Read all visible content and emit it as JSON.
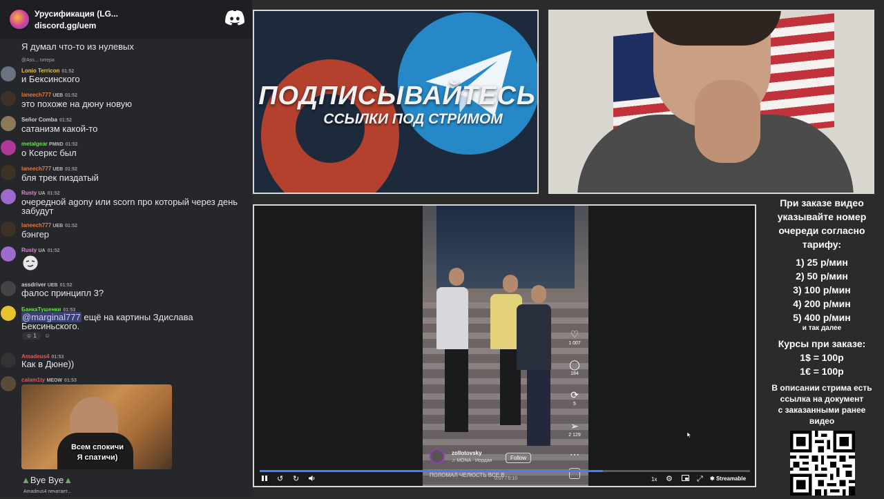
{
  "chat": {
    "server_name": "Урусификация (LG...",
    "server_link": "discord.gg/uem",
    "messages": [
      {
        "text": "Я думал что-то из нулевых"
      },
      {
        "reply": "@Ass... гитера",
        "user": "Lonio Terricon",
        "ts": "01:52",
        "text": "и Бексинского",
        "color": "#f0c53a"
      },
      {
        "user": "Ianeech777",
        "badge": "UEB",
        "ts": "01:52",
        "text": "это похоже на дюну новую",
        "color": "#e9783a"
      },
      {
        "user": "Señor Comba",
        "ts": "01:52",
        "text": "сатанизм какой-то",
        "color": "#cfcfcf"
      },
      {
        "user": "metalgear",
        "badge": "PMND",
        "ts": "01:52",
        "text": "о Ксеркс был",
        "color": "#6fdc5a"
      },
      {
        "user": "Ianeech777",
        "badge": "UEB",
        "ts": "01:52",
        "text": "бля трек пиздатый",
        "color": "#e9783a"
      },
      {
        "user": "Rusty",
        "badge": "UA",
        "ts": "01:52",
        "text": "очередной agony или scorn про который через день забудут",
        "color": "#d98bd8"
      },
      {
        "user": "Ianeech777",
        "badge": "UEB",
        "ts": "01:52",
        "text": "бэнгер",
        "color": "#e9783a"
      },
      {
        "user": "Rusty",
        "badge": "UA",
        "ts": "01:52",
        "text": "",
        "color": "#d98bd8"
      },
      {
        "user": "assdriver",
        "badge": "UEB",
        "ts": "01:52",
        "text": "фалос принципл 3?",
        "color": "#cfcfcf"
      },
      {
        "user": "БанкаТушенки",
        "ts": "01:53",
        "mention": "@marginal777",
        "text": " ещё на картины Здислава Бексиньского.",
        "reactions": "1",
        "color": "#6fdc5a"
      },
      {
        "user": "Amadeus4",
        "ts": "01:53",
        "text": "Как в Дюне))",
        "color": "#e05a5a"
      },
      {
        "user": "calam1ty",
        "badge": "MEOW",
        "ts": "01:53",
        "text": "",
        "color": "#e05a5a"
      }
    ],
    "cam_caption_1": "Всем спокичи",
    "cam_caption_2": "Я спатичи)",
    "last_text": "Bye Bye",
    "typing": "Amadeus4 печатает..."
  },
  "banner": {
    "title": "ПОДПИСЫВАЙТЕСЬ",
    "subtitle": "ССЫЛКИ ПОД СТРИМОМ"
  },
  "player": {
    "likes": "1 007",
    "comments": "184",
    "reposts": "5",
    "shares": "2 129",
    "handle": "zollotovsky",
    "music": "♫ MONA · Иордан",
    "follow": "Follow",
    "caption": "ПОЛОМАЛ ЧЕЛЮСТЬ ВСЕ В...",
    "time": "0:07 / 0:10",
    "speed": "1x",
    "brand": "Streamable",
    "progress": 0.7
  },
  "info": {
    "lines": [
      "При заказе видео",
      "указывайте номер",
      "очереди согласно",
      "тарифу:"
    ],
    "tariffs": [
      "1) 25 р/мин",
      "2) 50 р/мин",
      "3) 100 р/мин",
      "4) 200 р/мин",
      "5) 400 р/мин"
    ],
    "etc": "и так далее",
    "course_title": "Курсы при заказе:",
    "courses": [
      "1$ = 100р",
      "1€ = 100р"
    ],
    "desc": [
      "В описании стрима есть",
      "ссылка на документ",
      "с заказанными ранее",
      "видео"
    ]
  },
  "colors": {
    "discord_blurple": "#5865f2",
    "accent_blue": "#3b82f6",
    "patreon": "#c4442c",
    "telegram": "#2688c6"
  }
}
